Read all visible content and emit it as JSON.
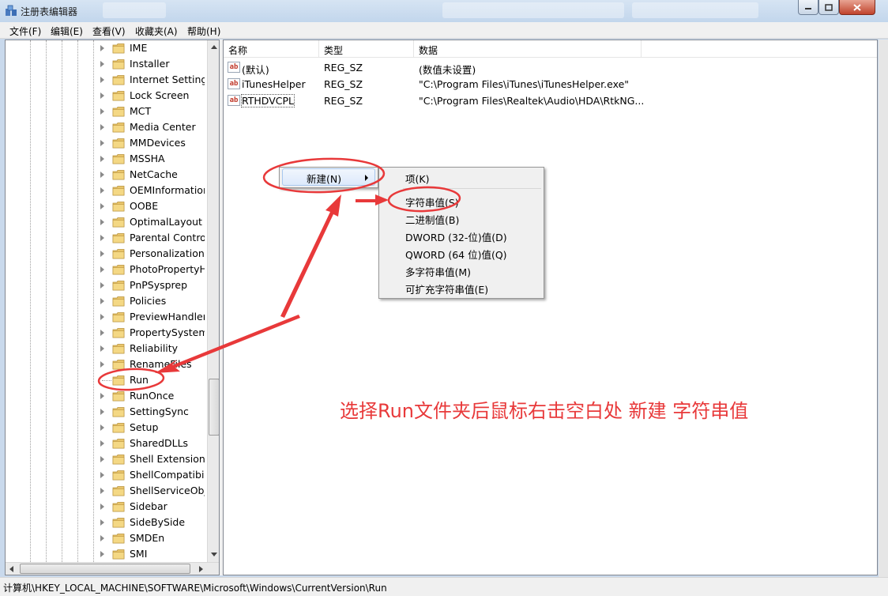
{
  "window": {
    "title": "注册表编辑器",
    "controls": {
      "minimize": "minimize-icon",
      "maximize": "maximize-icon",
      "close": "close-icon"
    }
  },
  "menubar": {
    "items": [
      "文件(F)",
      "编辑(E)",
      "查看(V)",
      "收藏夹(A)",
      "帮助(H)"
    ]
  },
  "tree": {
    "items": [
      {
        "label": "IME"
      },
      {
        "label": "Installer"
      },
      {
        "label": "Internet Settings"
      },
      {
        "label": "Lock Screen"
      },
      {
        "label": "MCT"
      },
      {
        "label": "Media Center"
      },
      {
        "label": "MMDevices"
      },
      {
        "label": "MSSHA"
      },
      {
        "label": "NetCache"
      },
      {
        "label": "OEMInformation"
      },
      {
        "label": "OOBE"
      },
      {
        "label": "OptimalLayout"
      },
      {
        "label": "Parental Controls"
      },
      {
        "label": "Personalization"
      },
      {
        "label": "PhotoPropertyHandler"
      },
      {
        "label": "PnPSysprep"
      },
      {
        "label": "Policies"
      },
      {
        "label": "PreviewHandlers"
      },
      {
        "label": "PropertySystem"
      },
      {
        "label": "Reliability"
      },
      {
        "label": "RenameFiles"
      },
      {
        "label": "Run",
        "selected": true
      },
      {
        "label": "RunOnce"
      },
      {
        "label": "SettingSync"
      },
      {
        "label": "Setup"
      },
      {
        "label": "SharedDLLs"
      },
      {
        "label": "Shell Extensions"
      },
      {
        "label": "ShellCompatibility"
      },
      {
        "label": "ShellServiceObjects"
      },
      {
        "label": "Sidebar"
      },
      {
        "label": "SideBySide"
      },
      {
        "label": "SMDEn"
      },
      {
        "label": "SMI"
      }
    ]
  },
  "list": {
    "columns": [
      "名称",
      "类型",
      "数据"
    ],
    "rows": [
      {
        "name": "(默认)",
        "type": "REG_SZ",
        "data": "(数值未设置)"
      },
      {
        "name": "iTunesHelper",
        "type": "REG_SZ",
        "data": "\"C:\\Program Files\\iTunes\\iTunesHelper.exe\""
      },
      {
        "name": "RTHDVCPL",
        "type": "REG_SZ",
        "data": "\"C:\\Program Files\\Realtek\\Audio\\HDA\\RtkNG..."
      }
    ]
  },
  "context_menu": {
    "new_label": "新建(N)"
  },
  "submenu": {
    "items": [
      "项(K)",
      "字符串值(S)",
      "二进制值(B)",
      "DWORD (32-位)值(D)",
      "QWORD (64 位)值(Q)",
      "多字符串值(M)",
      "可扩充字符串值(E)"
    ]
  },
  "annotation": {
    "caption": "选择Run文件夹后鼠标右击空白处 新建 字符串值",
    "color": "#e8393a"
  },
  "statusbar": {
    "path": "计算机\\HKEY_LOCAL_MACHINE\\SOFTWARE\\Microsoft\\Windows\\CurrentVersion\\Run"
  }
}
